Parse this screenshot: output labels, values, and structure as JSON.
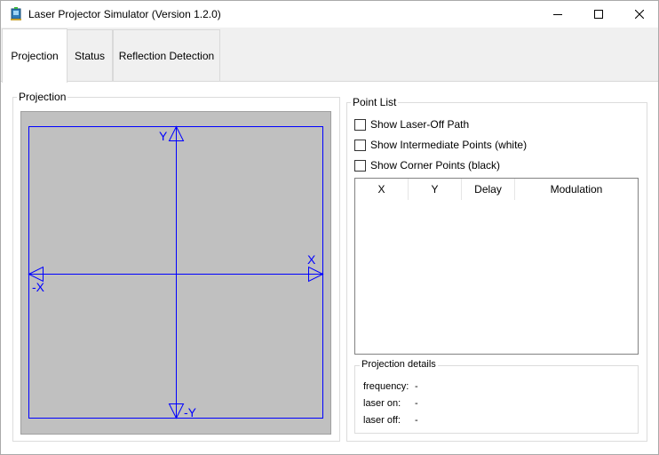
{
  "window": {
    "title": "Laser Projector Simulator (Version 1.2.0)",
    "icon": "app-laser-icon"
  },
  "tabs": [
    {
      "label": "Projection",
      "active": true
    },
    {
      "label": "Status",
      "active": false
    },
    {
      "label": "Reflection Detection",
      "active": false
    }
  ],
  "projection": {
    "group_label": "Projection",
    "axes": {
      "x_pos": "X",
      "x_neg": "-X",
      "y_pos": "Y",
      "y_neg": "-Y"
    },
    "colors": {
      "axis": "#0000ff",
      "canvas": "#c0c0c0"
    }
  },
  "point_list": {
    "group_label": "Point List",
    "options": [
      {
        "label": "Show Laser-Off Path",
        "checked": false
      },
      {
        "label": "Show Intermediate Points (white)",
        "checked": false
      },
      {
        "label": "Show Corner Points (black)",
        "checked": false
      }
    ],
    "columns": [
      "X",
      "Y",
      "Delay",
      "Modulation"
    ],
    "rows": []
  },
  "details": {
    "group_label": "Projection details",
    "frequency": {
      "label": "frequency:",
      "value": "-"
    },
    "laser_on": {
      "label": "laser on:",
      "value": "-"
    },
    "laser_off": {
      "label": "laser off:",
      "value": "-"
    }
  }
}
